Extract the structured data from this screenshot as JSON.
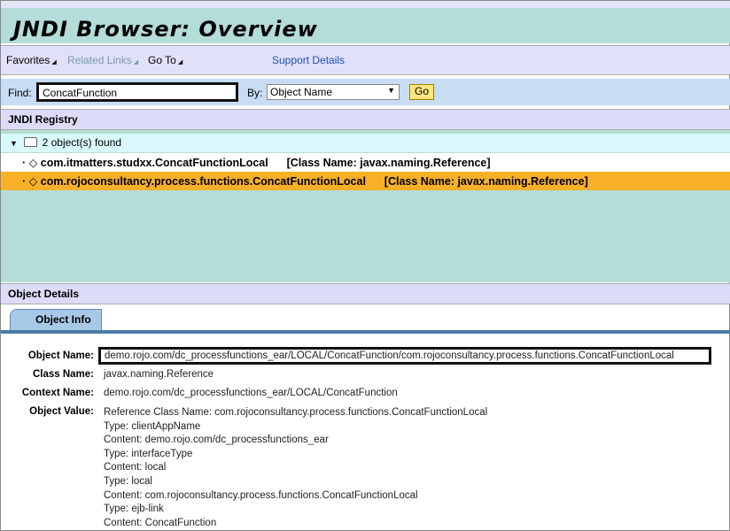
{
  "header": {
    "title": "JNDI Browser: Overview"
  },
  "nav": {
    "favorites": "Favorites",
    "related_links": "Related Links",
    "go_to": "Go To",
    "support_details": "Support Details"
  },
  "search": {
    "find_label": "Find:",
    "find_value": "ConcatFunction",
    "by_label": "By:",
    "by_value": "Object Name",
    "go_label": "Go"
  },
  "registry": {
    "title": "JNDI Registry",
    "summary": "2 object(s) found",
    "items": [
      {
        "name": "com.itmatters.studxx.ConcatFunctionLocal",
        "class": "[Class Name: javax.naming.Reference]",
        "selected": false
      },
      {
        "name": "com.rojoconsultancy.process.functions.ConcatFunctionLocal",
        "class": "[Class Name: javax.naming.Reference]",
        "selected": true
      }
    ]
  },
  "details": {
    "title": "Object Details",
    "tab": "Object Info",
    "object_name_label": "Object Name:",
    "object_name": "demo.rojo.com/dc_processfunctions_ear/LOCAL/ConcatFunction/com.rojoconsultancy.process.functions.ConcatFunctionLocal",
    "class_name_label": "Class Name:",
    "class_name": "javax.naming.Reference",
    "context_name_label": "Context Name:",
    "context_name": "demo.rojo.com/dc_processfunctions_ear/LOCAL/ConcatFunction",
    "object_value_label": "Object Value:",
    "object_value": [
      "Reference Class Name: com.rojoconsultancy.process.functions.ConcatFunctionLocal",
      "Type: clientAppName",
      "Content: demo.rojo.com/dc_processfunctions_ear",
      "Type: interfaceType",
      "Content: local",
      "Type: local",
      "Content: com.rojoconsultancy.process.functions.ConcatFunctionLocal",
      "Type: ejb-link",
      "Content: ConcatFunction"
    ]
  },
  "colors": {
    "selected_row": "#f8b028",
    "title_band": "#b4dcd8",
    "nav_bar": "#e0e0f8",
    "link": "#2050b0"
  }
}
